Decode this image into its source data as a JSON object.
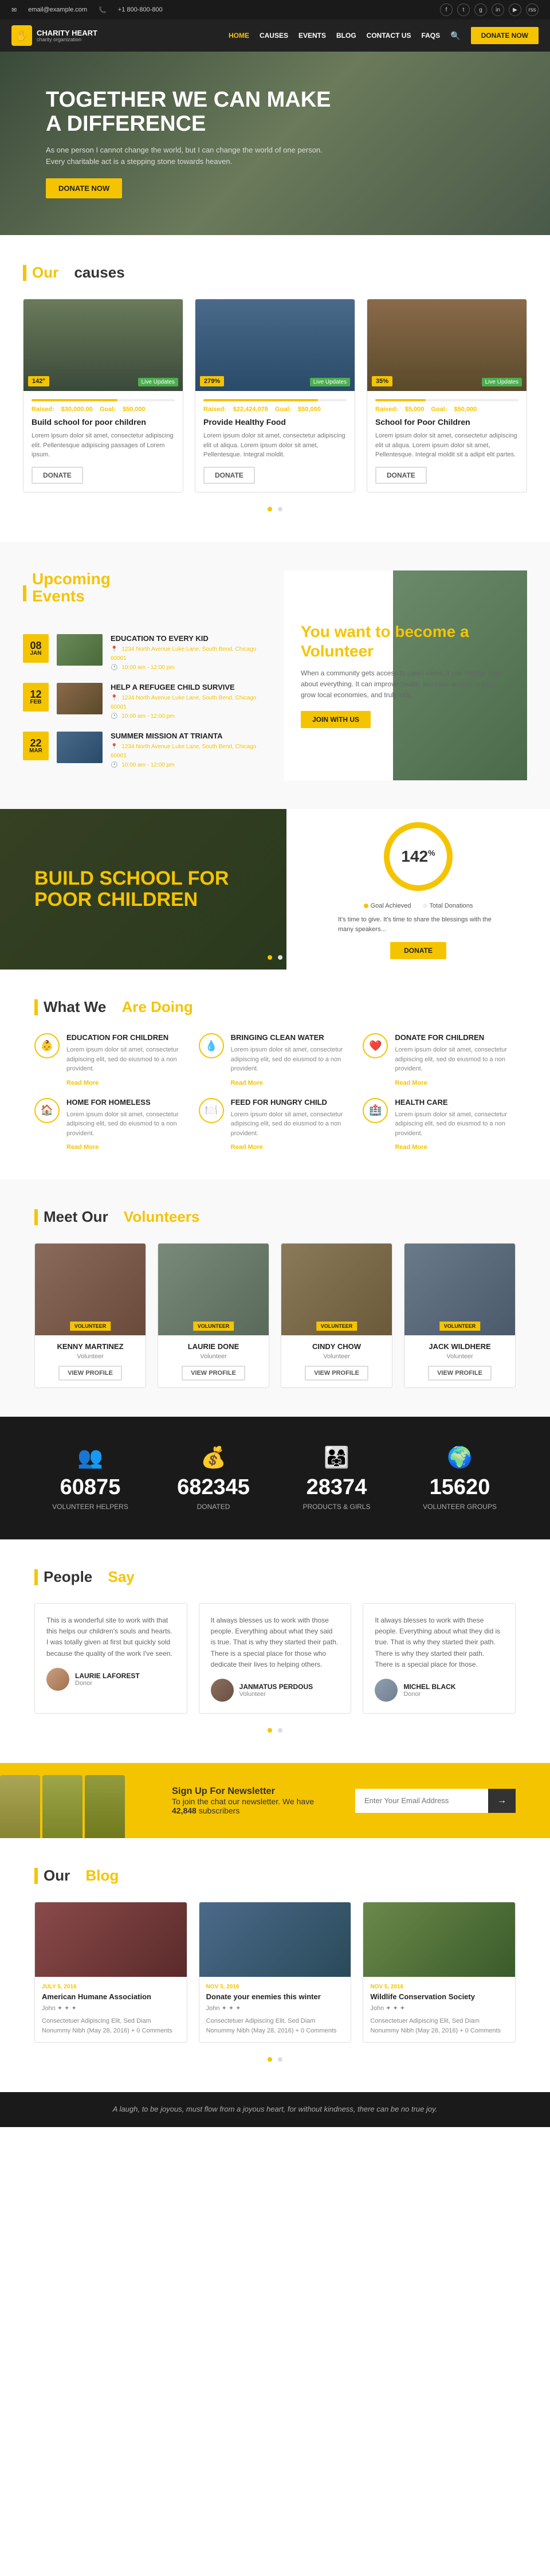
{
  "topbar": {
    "email_label": "Email",
    "email_value": "email@example.com",
    "phone_label": "Phone",
    "phone_value": "+1 800-800-800",
    "social": [
      "f",
      "t",
      "g+",
      "in",
      "yt",
      "rss"
    ]
  },
  "nav": {
    "logo_name": "CHARITY HEART",
    "links": [
      "Home",
      "Causes",
      "Events",
      "Blog",
      "Contact Us",
      "FAQs"
    ],
    "active": "Home",
    "donate_label": "DONATE NOW"
  },
  "hero": {
    "title": "TOGETHER WE CAN MAKE A DIFFERENCE",
    "subtitle": "As one person I cannot change the world, but I can change the world of one person. Every charitable act is a stepping stone towards heaven.",
    "cta": "DONATE NOW"
  },
  "causes": {
    "section_title": "Our",
    "section_title2": "causes",
    "items": [
      {
        "title": "Build school for poor children",
        "description": "Lorem ipsum dolor sit amet, consectetur adipiscing elit. Pellentesque adipiscing passages of Lorem ipsum.",
        "raised_label": "Raised:",
        "raised_value": "$30,000.00",
        "goal_label": "Goal:",
        "goal_value": "$50,000",
        "badge": "142°",
        "progress": 60,
        "donate": "DONATE"
      },
      {
        "title": "Provide Healthy Food",
        "description": "Lorem ipsum dolor sit amet, consectetur adipiscing elit ut aliqua. Lorem ipsum dolor sit amet, Pellentesque. Integral moldit.",
        "raised_label": "Raised:",
        "raised_value": "$22,424,078",
        "goal_label": "Goal:",
        "goal_value": "$50,000",
        "badge": "279%",
        "progress": 80,
        "donate": "DONATE"
      },
      {
        "title": "School for Poor Children",
        "description": "Lorem ipsum dolor sit amet, consectetur adipiscing elit ut aliqua. Lorem ipsum dolor sit amet, Pellentesque. Integral moldit sit a adipit elit partes.",
        "raised_label": "Raised:",
        "raised_value": "$5,000",
        "goal_label": "Goal:",
        "goal_value": "$50,000",
        "badge": "35%",
        "progress": 35,
        "donate": "DONATE"
      }
    ]
  },
  "events": {
    "section_title": "Upcoming",
    "section_subtitle": "Events",
    "items": [
      {
        "day": "08",
        "month": "JAN",
        "title": "EDUCATION TO EVERY KID",
        "location": "1234 North Avenue Luke Lane,\nSouth Bend, Chicago 60001",
        "time": "10:00 am - 12:00 pm"
      },
      {
        "day": "12",
        "month": "FEB",
        "title": "HELP A REFUGEE CHILD SURVIVE",
        "location": "1234 North Avenue Luke Lane,\nSouth Bend, Chicago 60001",
        "time": "10:00 am - 12:00 pm"
      },
      {
        "day": "22",
        "month": "MAR",
        "title": "SUMMER MISSION AT TRIANTA",
        "location": "1234 North Avenue Luke Lane,\nSouth Bend, Chicago 60001",
        "time": "10:00 am - 12:00 pm"
      }
    ]
  },
  "volunteer": {
    "title": "You want to become a",
    "title_highlight": "Volunteer",
    "desc": "When a community gets access to clean water, it can change just about everything. It can improve health, increase access to food, grow local economies, and truly kids.",
    "cta": "JOIN WITH US"
  },
  "build_school": {
    "title": "Build school for poor children",
    "percent": "142",
    "label_raised": "Goal Achieved",
    "label_total": "Total Donations",
    "desc": "It's time to give. It's time to share the blessings with the many speakers...",
    "cta": "DONATE"
  },
  "what_we_do": {
    "section_title": "What We",
    "section_title2": "Are Doing",
    "items": [
      {
        "icon": "👶",
        "title": "EDUCATION FOR CHILDREN",
        "desc": "Lorem ipsum dolor sit amet, consectetur adipiscing elit, sed do eiusmod to a non provident.",
        "link": "Read More"
      },
      {
        "icon": "💧",
        "title": "BRINGING CLEAN WATER",
        "desc": "Lorem ipsum dolor sit amet, consectetur adipiscing elit, sed do eiusmod to a non provident.",
        "link": "Read More"
      },
      {
        "icon": "❤️",
        "title": "DONATE FOR CHILDREN",
        "desc": "Lorem ipsum dolor sit amet, consectetur adipiscing elit, sed do eiusmod to a non provident.",
        "link": "Read More"
      },
      {
        "icon": "🏠",
        "title": "HOME FOR HOMELESS",
        "desc": "Lorem ipsum dolor sit amet, consectetur adipiscing elit, sed do eiusmod to a non provident.",
        "link": "Read More"
      },
      {
        "icon": "🍽️",
        "title": "FEED FOR HUNGRY CHILD",
        "desc": "Lorem ipsum dolor sit amet, consectetur adipiscing elit, sed do eiusmod to a non provident.",
        "link": "Read More"
      },
      {
        "icon": "🏥",
        "title": "HEALTH CARE",
        "desc": "Lorem ipsum dolor sit amet, consectetur adipiscing elit, sed do eiusmod to a non provident.",
        "link": "Read More"
      }
    ]
  },
  "volunteers_section": {
    "section_title": "Meet Our",
    "section_title2": "Volunteers",
    "items": [
      {
        "name": "KENNY MARTINEZ",
        "role": "Volunteer",
        "btn": "VIEW PROFILE"
      },
      {
        "name": "LAURIE DONE",
        "role": "Volunteer",
        "btn": "VIEW PROFILE"
      },
      {
        "name": "CINDY CHOW",
        "role": "Volunteer",
        "btn": "VIEW PROFILE"
      },
      {
        "name": "JACK WILDHERE",
        "role": "Volunteer",
        "btn": "VIEW PROFILE"
      }
    ]
  },
  "stats": {
    "items": [
      {
        "icon": "👥",
        "number": "60875",
        "label": "Volunteer Helpers"
      },
      {
        "icon": "💰",
        "number": "682345",
        "label": "Donated"
      },
      {
        "icon": "👨‍👩‍👧",
        "number": "28374",
        "label": "Products & Girls"
      },
      {
        "icon": "🌍",
        "number": "15620",
        "label": "Volunteer Groups"
      }
    ]
  },
  "testimonials": {
    "section_title": "People",
    "section_title2": "Say",
    "items": [
      {
        "text": "This is a wonderful site to work with that this helps our children's souls and hearts. I was totally given at first but quickly sold because the quality of the work I've seen.",
        "name": "LAURIE LAFOREST",
        "title": "Donor"
      },
      {
        "text": "It always blesses us to work with those people. Everything about what they said is true. That is why they started their path. There is a special place for those who dedicate their lives to helping others.",
        "name": "JANMATUS PERDOUS",
        "title": "Volunteer"
      },
      {
        "text": "It always blesses to work with these people. Everything about what they did is true. That is why they started their path. There is why they started their path. There is a special place for those.",
        "name": "MICHEL BLACK",
        "title": "Donor"
      }
    ]
  },
  "newsletter": {
    "title": "Sign Up For Newsletter",
    "desc": "To join the chat our newsletter. We have",
    "highlight": "42,848",
    "desc2": "subscribers",
    "placeholder": "Enter Your Email Address",
    "btn_icon": "→"
  },
  "blog": {
    "section_title": "Our",
    "section_title2": "Blog",
    "items": [
      {
        "date": "JULY 5, 2016",
        "title": "American Humane Association",
        "author": "John ✦ ✦ ✦",
        "desc": "Consectetuer Adipiscing Elit, Sed Diam Nonummy Nibh (May 28, 2016) + 0 Comments"
      },
      {
        "date": "NOV 5, 2016",
        "title": "Donate your enemies this winter",
        "author": "John ✦ ✦ ✦",
        "desc": "Consectetuer Adipiscing Elit, Sed Diam Nonummy Nibh (May 28, 2016) + 0 Comments"
      },
      {
        "date": "NOV 5, 2016",
        "title": "Wildlife Conservation Society",
        "author": "John ✦ ✦ ✦",
        "desc": "Consectetuer Adipiscing Elit, Sed Diam Nonummy Nibh (May 28, 2016) + 0 Comments"
      }
    ]
  },
  "footer": {
    "quote": "A laugh, to be joyous, must flow from a joyous heart, for without kindness, there can be no true joy."
  }
}
